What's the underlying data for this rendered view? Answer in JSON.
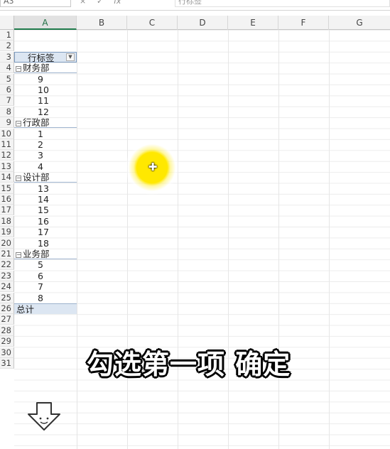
{
  "formula_bar": {
    "name_box": "A3",
    "icons": [
      "×",
      "✓",
      "fx"
    ],
    "formula": "行标签"
  },
  "columns": [
    "A",
    "B",
    "C",
    "D",
    "E",
    "F",
    "G"
  ],
  "rows": [
    "1",
    "2",
    "3",
    "4",
    "5",
    "6",
    "7",
    "8",
    "9",
    "10",
    "11",
    "12",
    "13",
    "14",
    "15",
    "16",
    "17",
    "18",
    "19",
    "20",
    "21",
    "22",
    "23",
    "24",
    "25",
    "26",
    "27",
    "28",
    "29",
    "30",
    "31"
  ],
  "pivot": {
    "header_label": "行标签",
    "dropdown_icon": "chevron-down-icon",
    "collapse_glyph": "⊟",
    "groups": [
      {
        "name": "财务部",
        "items": [
          "9",
          "10",
          "11",
          "12"
        ]
      },
      {
        "name": "行政部",
        "items": [
          "1",
          "2",
          "3",
          "4"
        ]
      },
      {
        "name": "设计部",
        "items": [
          "13",
          "14",
          "15",
          "16",
          "17",
          "18"
        ]
      },
      {
        "name": "业务部",
        "items": [
          "5",
          "6",
          "7",
          "8"
        ]
      }
    ],
    "total_label": "总计"
  },
  "caption": "勾选第一项 确定",
  "colors": {
    "highlight": "#ffe800",
    "pivot_header_bg": "#dce6f2",
    "selected_col": "#1f7a4a"
  }
}
